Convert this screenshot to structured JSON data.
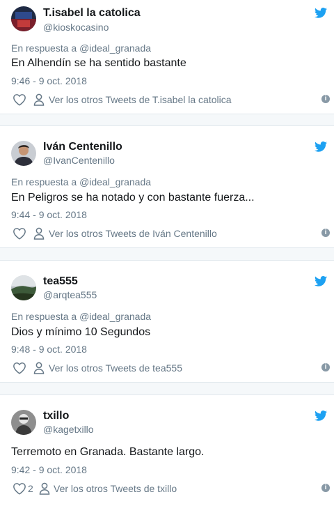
{
  "colors": {
    "accent": "#1da1f2",
    "muted": "#657786",
    "text": "#14171a"
  },
  "reply_prefix": "En respuesta a",
  "tweets": [
    {
      "name": "T.isabel la catolica",
      "handle": "@kioskocasino",
      "reply_to": "@ideal_granada",
      "text": "En Alhendín se ha sentido bastante",
      "time": "9:46 - 9 oct. 2018",
      "likes": "",
      "more_label": "Ver los otros Tweets de T.isabel la catolica"
    },
    {
      "name": "Iván Centenillo",
      "handle": "@IvanCentenillo",
      "reply_to": "@ideal_granada",
      "text": "En Peligros se ha notado y con bastante fuerza...",
      "time": "9:44 - 9 oct. 2018",
      "likes": "",
      "more_label": "Ver los otros Tweets de Iván Centenillo"
    },
    {
      "name": "tea555",
      "handle": "@arqtea555",
      "reply_to": "@ideal_granada",
      "text": "Dios y mínimo 10 Segundos",
      "time": "9:48 - 9 oct. 2018",
      "likes": "",
      "more_label": "Ver los otros Tweets de tea555"
    },
    {
      "name": "txillo",
      "handle": "@kagetxillo",
      "reply_to": "",
      "text": "Terremoto en Granada. Bastante largo.",
      "time": "9:42 - 9 oct. 2018",
      "likes": "2",
      "more_label": "Ver los otros Tweets de txillo"
    }
  ]
}
